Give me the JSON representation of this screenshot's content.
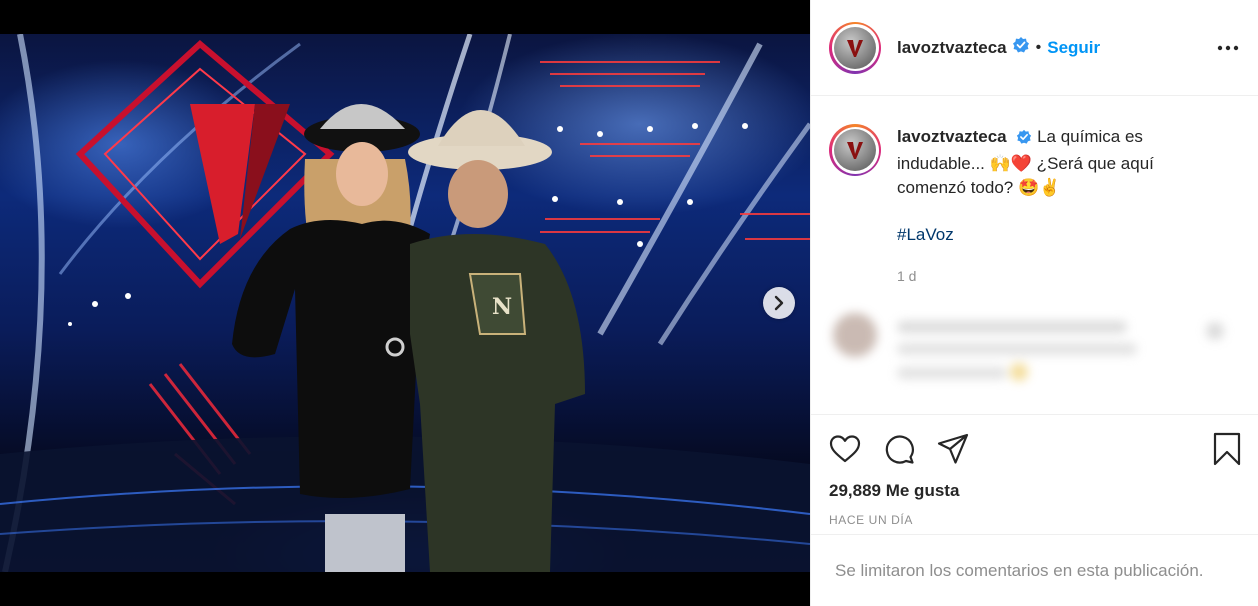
{
  "account": {
    "username": "lavoztvazteca",
    "follow_label": "Seguir",
    "separator": "•"
  },
  "caption": {
    "username": "lavoztvazteca",
    "text": "La química es indudable... 🙌❤️ ¿Será que aquí comenzó todo? 🤩✌️",
    "hashtag": "#LaVoz",
    "time_ago": "1 d"
  },
  "stats": {
    "likes": "29,889 Me gusta",
    "date": "HACE UN DÍA"
  },
  "comments_limited": "Se limitaron los comentarios en esta publicación.",
  "icons": {
    "verified": "verified-badge-icon",
    "more": "more-options-icon",
    "like": "heart-icon",
    "comment": "comment-icon",
    "share": "share-icon",
    "save": "bookmark-icon",
    "next": "chevron-right-icon"
  },
  "colors": {
    "follow": "#0095f6",
    "hashtag": "#00376b",
    "verified": "#3897f0",
    "muted": "#8e8e8e"
  }
}
